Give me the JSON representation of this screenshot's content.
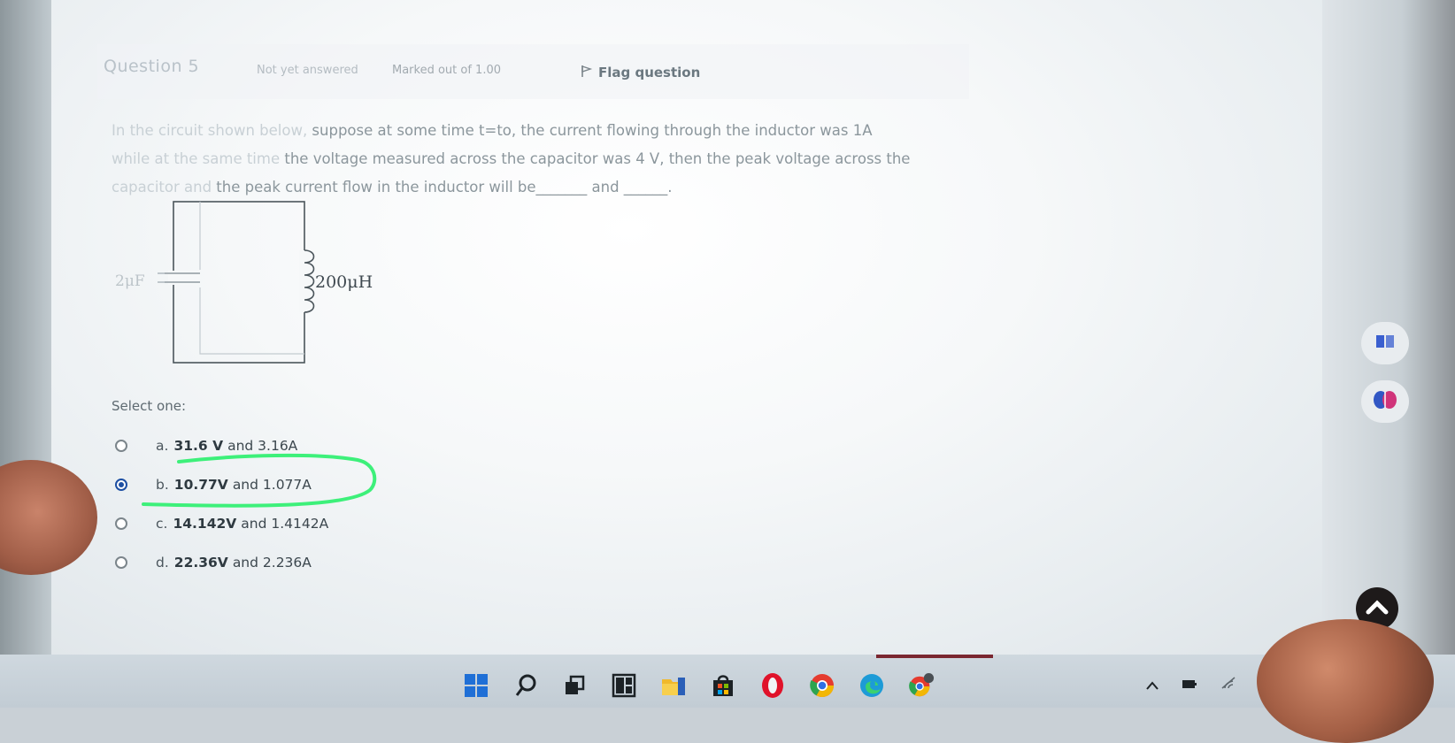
{
  "question": {
    "number_label": "Question 5",
    "status": "Not yet answered",
    "marks": "Marked out of 1.00",
    "flag_label": "Flag question",
    "text_faint_1": "In the circuit shown below,",
    "text_1": " suppose at some time t=to, the current flowing through the inductor was 1A",
    "text_faint_2": "while at the same time",
    "text_2": " the voltage measured across the capacitor was 4 V, then the peak voltage across the",
    "text_faint_3": "capacitor and",
    "text_3": " the peak current flow in the inductor will be_______ and ______."
  },
  "circuit": {
    "capacitor_label": "2μF",
    "inductor_label": "200μH"
  },
  "select_label": "Select one:",
  "options": [
    {
      "letter": "a.",
      "bold": "31.6 V",
      "rest": "and 3.16A",
      "selected": false
    },
    {
      "letter": "b.",
      "bold": "10.77V",
      "rest": "and 1.077A",
      "selected": true
    },
    {
      "letter": "c.",
      "bold": "14.142V",
      "rest": "and 1.4142A",
      "selected": false
    },
    {
      "letter": "d.",
      "bold": "22.36V",
      "rest": "and 2.236A",
      "selected": false
    }
  ],
  "colors": {
    "highlight": "#3df07a",
    "radio_selected": "#1d4fa3"
  },
  "taskbar_icons": [
    "windows-start-icon",
    "search-icon",
    "task-view-icon",
    "widgets-icon",
    "file-explorer-icon",
    "store-icon",
    "opera-icon",
    "chrome-icon",
    "edge-icon",
    "chrome-alt-icon"
  ]
}
